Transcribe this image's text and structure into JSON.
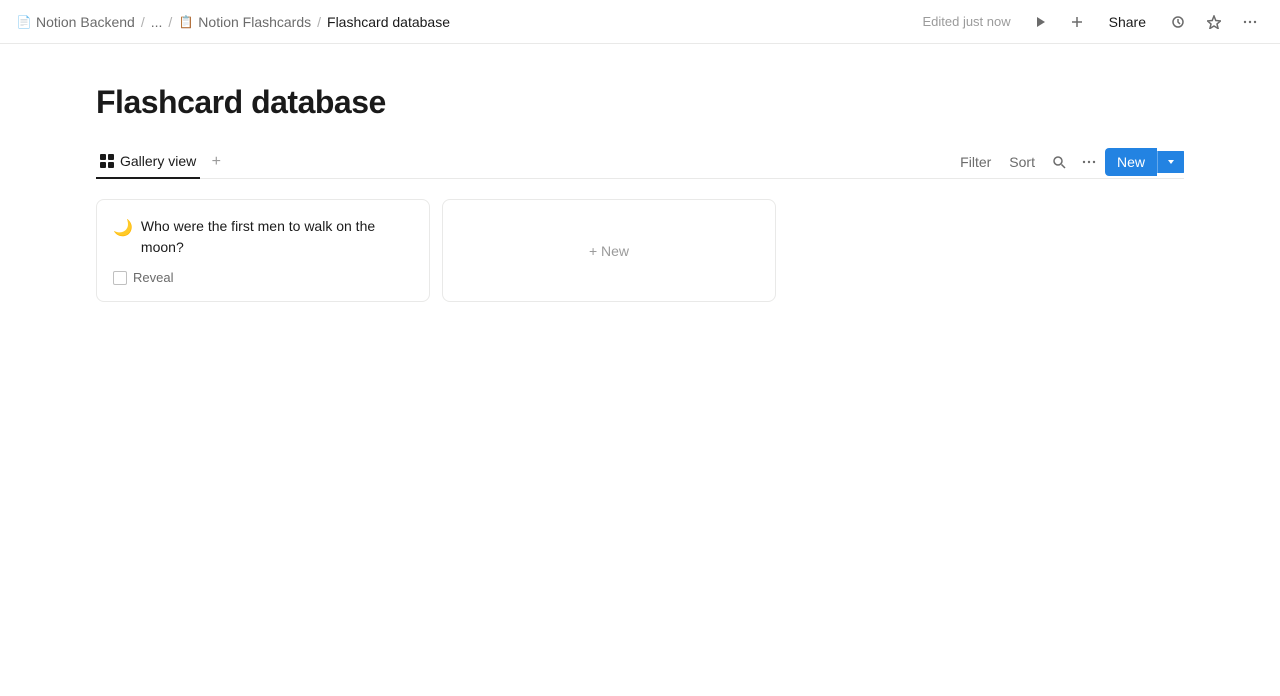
{
  "breadcrumb": {
    "items": [
      {
        "label": "Notion Backend",
        "icon": "📄",
        "id": "notion-backend"
      },
      {
        "label": "...",
        "id": "ellipsis"
      },
      {
        "label": "Notion Flashcards",
        "icon": "📋",
        "id": "notion-flashcards"
      },
      {
        "label": "Flashcard database",
        "id": "flashcard-database"
      }
    ]
  },
  "topbar": {
    "edited_label": "Edited just now",
    "share_label": "Share"
  },
  "page": {
    "title": "Flashcard database"
  },
  "views": {
    "tabs": [
      {
        "label": "Gallery view",
        "active": true
      }
    ],
    "add_tab_title": "Add a view"
  },
  "toolbar": {
    "filter_label": "Filter",
    "sort_label": "Sort",
    "new_label": "New",
    "more_label": "···"
  },
  "gallery": {
    "cards": [
      {
        "emoji": "🌙",
        "question": "Who were the first men to walk on the moon?",
        "reveal_label": "Reveal"
      }
    ],
    "new_card_label": "+ New"
  }
}
